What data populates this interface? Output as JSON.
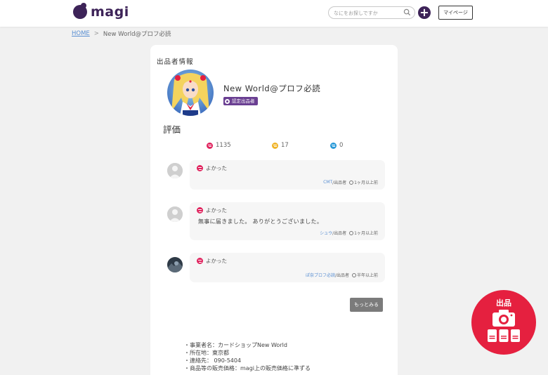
{
  "header": {
    "logo_text": "magi",
    "search_placeholder": "なにをお探しですか",
    "mypage_label": "マイページ",
    "plus_label": "+"
  },
  "breadcrumb": {
    "home": "HOME",
    "separator": ">",
    "current": "New World@プロフ必読"
  },
  "seller": {
    "section_title": "出品者情報",
    "name": "New World@プロフ必読",
    "verified_badge": "認定出品者"
  },
  "ratings": {
    "heading": "評価",
    "good_count": "1135",
    "normal_count": "17",
    "bad_count": "0"
  },
  "reviews": [
    {
      "rating": "よかった",
      "comment": "",
      "reviewer": "CMT",
      "role": "/出品者",
      "time": "1ヶ月以上前"
    },
    {
      "rating": "よかった",
      "comment": "無事に届きました。 ありがとうございました。",
      "reviewer": "シュウ",
      "role": "/出品者",
      "time": "1ヶ月以上前"
    },
    {
      "rating": "よかった",
      "comment": "",
      "reviewer": "ぽ奈プロフ必読",
      "role": "/出品者",
      "time": "半年以上前"
    }
  ],
  "more_label": "もっとみる",
  "seller_info": {
    "line1": "・事業者名：カードショップNew World",
    "line2": "・所在地：東京都",
    "line3": "・連絡先： 090-5404",
    "line4": "・商品等の販売価格：magi上の販売価格に準ずる"
  },
  "sell_button": {
    "label": "出品"
  },
  "colors": {
    "brand": "#3d2358",
    "accent_red": "#e5203f",
    "badge_purple": "#6a3f92",
    "link_blue": "#5a8fd2"
  }
}
